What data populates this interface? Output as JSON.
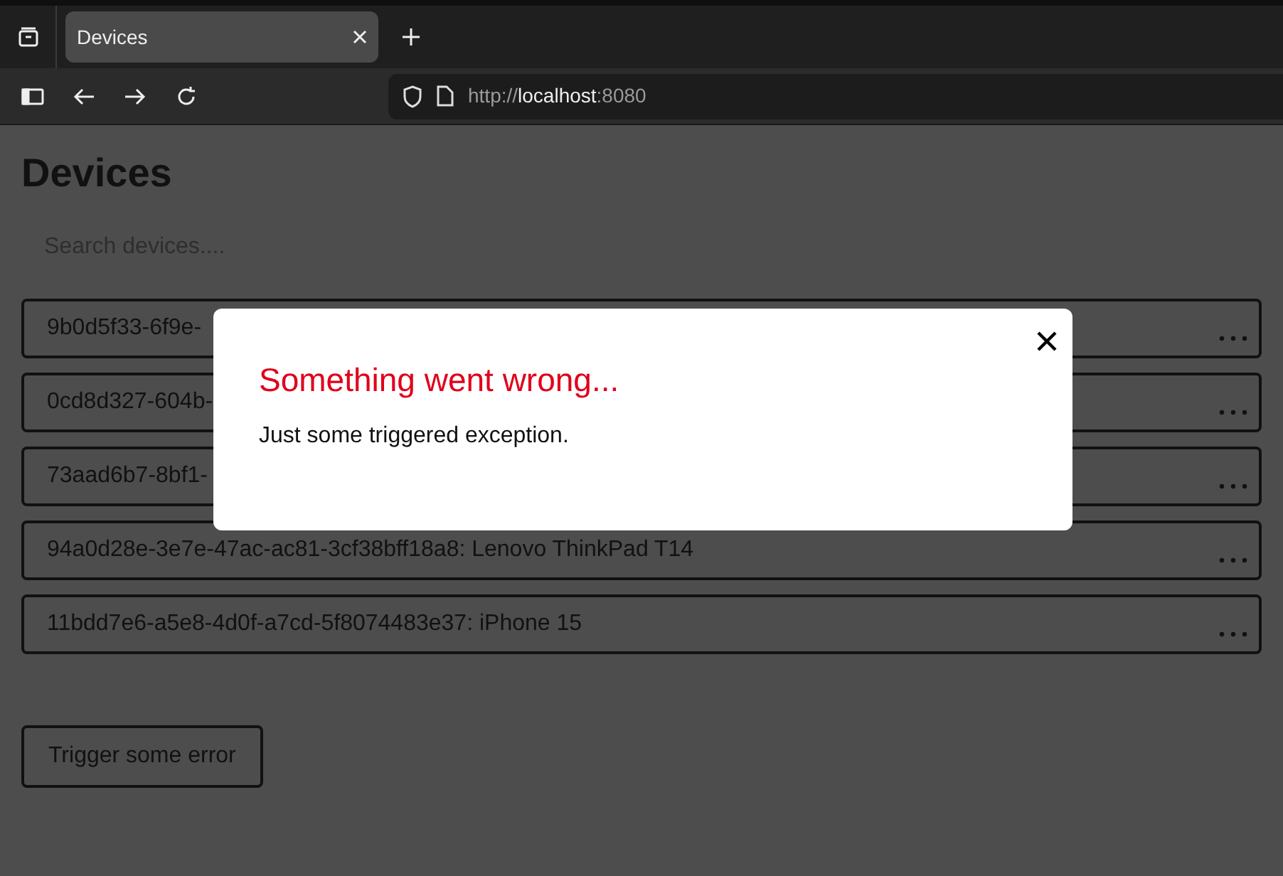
{
  "browser": {
    "tab": {
      "title": "Devices",
      "selected": true
    },
    "url": {
      "scheme": "http://",
      "host": "localhost",
      "port": ":8080"
    }
  },
  "page": {
    "title": "Devices",
    "search": {
      "placeholder": "Search devices...."
    },
    "devices": [
      {
        "label": "9b0d5f33-6f9e-"
      },
      {
        "label": "0cd8d327-604b-"
      },
      {
        "label": "73aad6b7-8bf1-"
      },
      {
        "label": "94a0d28e-3e7e-47ac-ac81-3cf38bff18a8: Lenovo ThinkPad T14"
      },
      {
        "label": "11bdd7e6-a5e8-4d0f-a7cd-5f8074483e37: iPhone 15"
      }
    ],
    "button": "Trigger some error"
  },
  "dialog": {
    "title": "Something went wrong...",
    "message": "Just some triggered exception."
  }
}
